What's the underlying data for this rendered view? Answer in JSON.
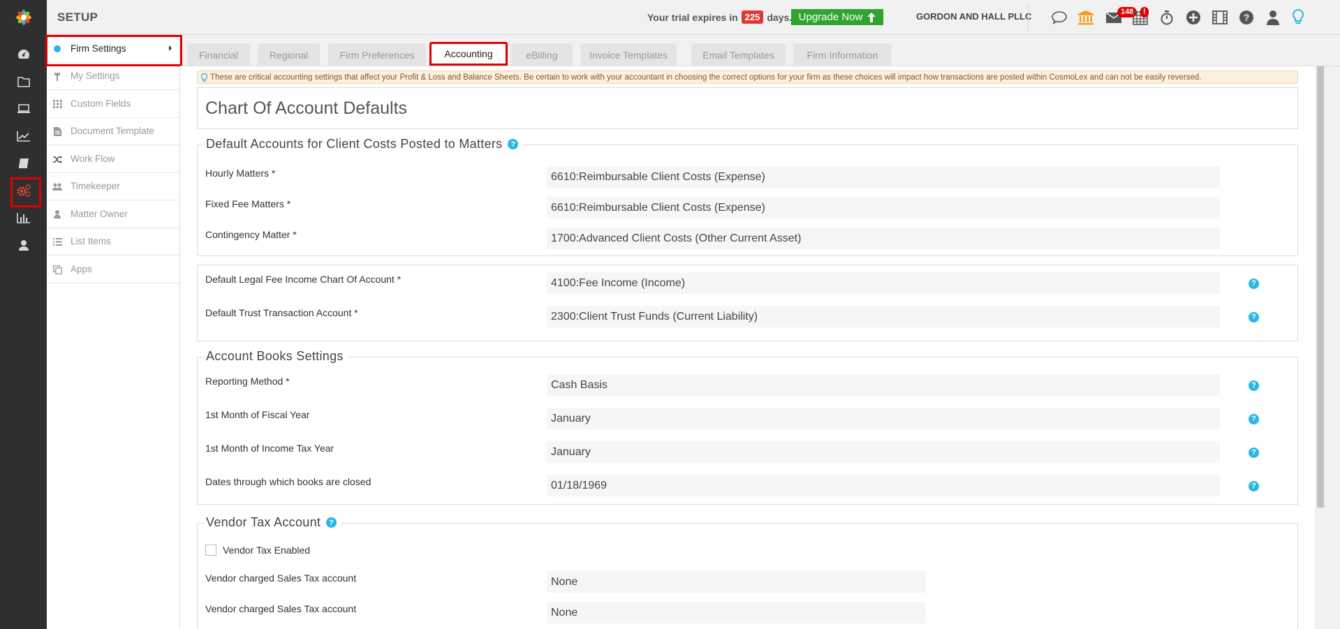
{
  "header": {
    "title": "SETUP",
    "trial_prefix": "Your trial expires in",
    "trial_days": "225",
    "trial_suffix": "days.",
    "upgrade_label": "Upgrade Now",
    "firm_name": "GORDON AND HALL PLLC",
    "mail_badge": "148",
    "calendar_badge": "!"
  },
  "sidebar": {
    "items": [
      {
        "label": "Firm Settings",
        "icon": "dot-icon",
        "active": true
      },
      {
        "label": "My Settings",
        "icon": "wrench-icon"
      },
      {
        "label": "Custom Fields",
        "icon": "grid-icon"
      },
      {
        "label": "Document Template",
        "icon": "document-icon"
      },
      {
        "label": "Work Flow",
        "icon": "shuffle-icon"
      },
      {
        "label": "Timekeeper",
        "icon": "users-icon"
      },
      {
        "label": "Matter Owner",
        "icon": "user-icon"
      },
      {
        "label": "List Items",
        "icon": "list-icon"
      },
      {
        "label": "Apps",
        "icon": "copy-icon"
      }
    ]
  },
  "tabs": [
    {
      "label": "Financial"
    },
    {
      "label": "Regional"
    },
    {
      "label": "Firm Preferences"
    },
    {
      "label": "Accounting",
      "active": true
    },
    {
      "label": "eBilling"
    },
    {
      "label": "Invoice Templates"
    },
    {
      "label": "Email Templates"
    },
    {
      "label": "Firm Information"
    }
  ],
  "notice": "These are critical accounting settings that affect your Profit & Loss and Balance Sheets. Be certain to work with your accountant in choosing the correct options for your firm as these choices will impact how transactions are posted within CosmoLex and can not be easily reversed.",
  "page_heading": "Chart Of Account Defaults",
  "client_costs": {
    "legend": "Default Accounts for Client Costs Posted to Matters",
    "rows": [
      {
        "label": "Hourly Matters *",
        "value": "6610:Reimbursable Client Costs (Expense)"
      },
      {
        "label": "Fixed Fee Matters *",
        "value": "6610:Reimbursable Client Costs (Expense)"
      },
      {
        "label": "Contingency Matter *",
        "value": "1700:Advanced Client Costs (Other Current Asset)"
      }
    ]
  },
  "defaults": {
    "rows": [
      {
        "label": "Default Legal Fee Income Chart Of Account *",
        "value": "4100:Fee Income (Income)"
      },
      {
        "label": "Default Trust Transaction Account *",
        "value": "2300:Client Trust Funds (Current Liability)"
      }
    ]
  },
  "books": {
    "legend": "Account Books Settings",
    "rows": [
      {
        "label": "Reporting Method *",
        "value": "Cash Basis"
      },
      {
        "label": "1st Month of Fiscal Year",
        "value": "January"
      },
      {
        "label": "1st Month of Income Tax Year",
        "value": "January"
      },
      {
        "label": "Dates through which books are closed",
        "value": "01/18/1969"
      }
    ]
  },
  "vendor_tax": {
    "legend": "Vendor Tax Account",
    "checkbox_label": "Vendor Tax Enabled",
    "checked": false,
    "rows": [
      {
        "label": "Vendor charged Sales Tax account",
        "value": "None"
      },
      {
        "label": "Vendor charged Sales Tax account",
        "value": "None"
      }
    ]
  },
  "colors": {
    "accent_blue": "#29b6e6",
    "highlight_red": "#e00000",
    "upgrade_green": "#2fa52f",
    "rail_dark": "#2f2f2f"
  }
}
